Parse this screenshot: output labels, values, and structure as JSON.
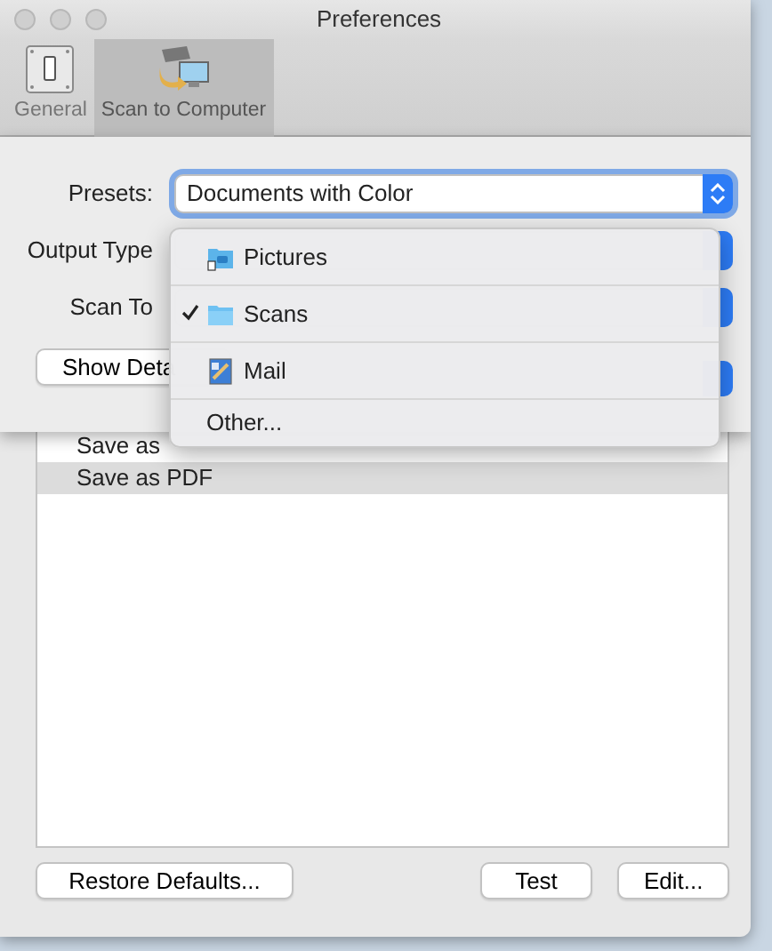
{
  "window": {
    "title": "Preferences"
  },
  "toolbar": [
    {
      "label": "General",
      "selected": false
    },
    {
      "label": "Scan to Computer",
      "selected": true
    }
  ],
  "list": [
    {
      "label": "Save as",
      "selected": false
    },
    {
      "label": "Save as PDF",
      "selected": true
    }
  ],
  "buttons": [
    "Restore Defaults...",
    "Test",
    "Edit..."
  ],
  "sheet": {
    "fields": [
      {
        "label": "Presets:",
        "value": "Documents with Color"
      },
      {
        "label": "Output Type"
      },
      {
        "label": "Scan To"
      }
    ],
    "show_details": "Show Deta"
  },
  "menu": [
    {
      "kind": "pictures",
      "label": "Pictures",
      "checked": false
    },
    {
      "kind": "folder",
      "label": "Scans",
      "checked": true
    },
    {
      "kind": "app",
      "label": "Mail",
      "checked": false
    },
    {
      "kind": "plain",
      "label": "Other...",
      "checked": false
    }
  ]
}
